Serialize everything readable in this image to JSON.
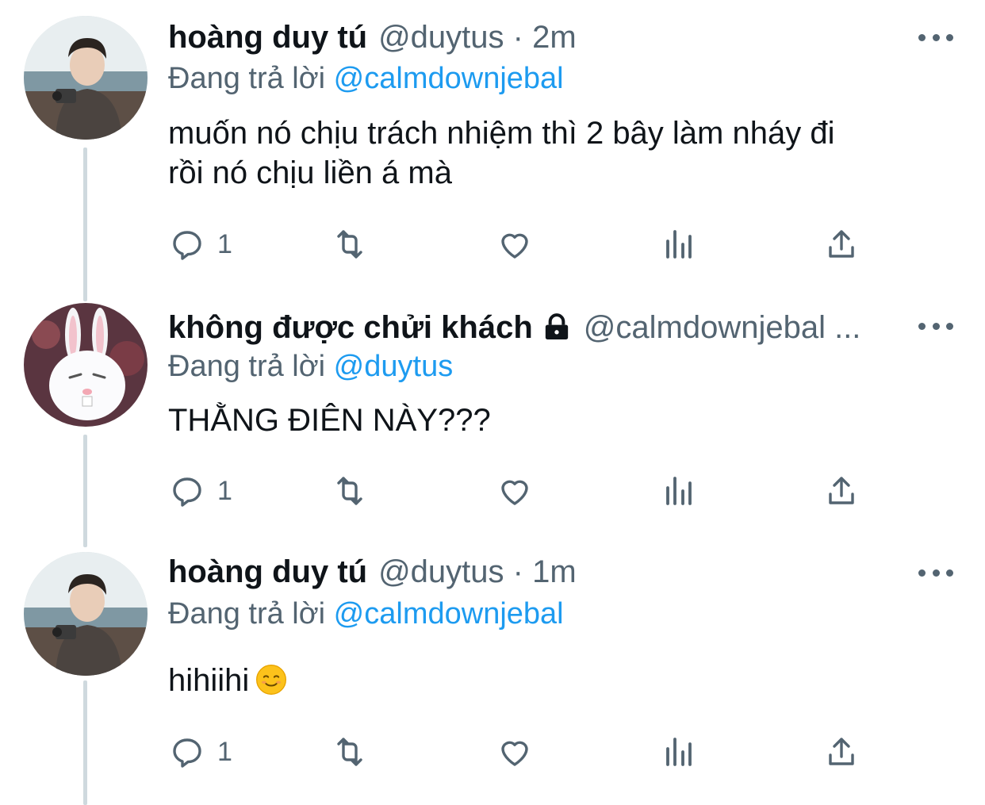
{
  "colors": {
    "mention": "#1d9bf0",
    "secondary_text": "#536471",
    "thread_line": "#cfd9de"
  },
  "tweets": [
    {
      "name": "hoàng duy tú",
      "handle": "@duytus",
      "time": "· 2m",
      "meta": "@duytus · 2m",
      "reply_prefix": "Đang trả lời",
      "reply_mention": "@calmdownjebal",
      "text_line1": "muốn nó chịu trách nhiệm thì 2 bây làm nháy đi",
      "text_line2": "rồi nó chịu liền á mà",
      "reply_count": "1",
      "avatar": "avatar-photo-man-camera",
      "locked": false
    },
    {
      "name": "không được chửi khách",
      "meta": "@calmdownjebal ...",
      "reply_prefix": "Đang trả lời",
      "reply_mention": "@duytus",
      "text_line1": "THẰNG ĐIÊN NÀY???",
      "reply_count": "1",
      "avatar": "avatar-white-rabbit",
      "locked": true
    },
    {
      "name": "hoàng duy tú",
      "meta": "@duytus · 1m",
      "reply_prefix": "Đang trả lời",
      "reply_mention": "@calmdownjebal",
      "text_line1": "hihiihi",
      "emoji": "smiling-face-emoji",
      "reply_count": "1",
      "avatar": "avatar-photo-man-camera",
      "locked": false
    }
  ],
  "action_icons": [
    "reply-icon",
    "retweet-icon",
    "like-icon",
    "analytics-icon",
    "share-icon"
  ]
}
